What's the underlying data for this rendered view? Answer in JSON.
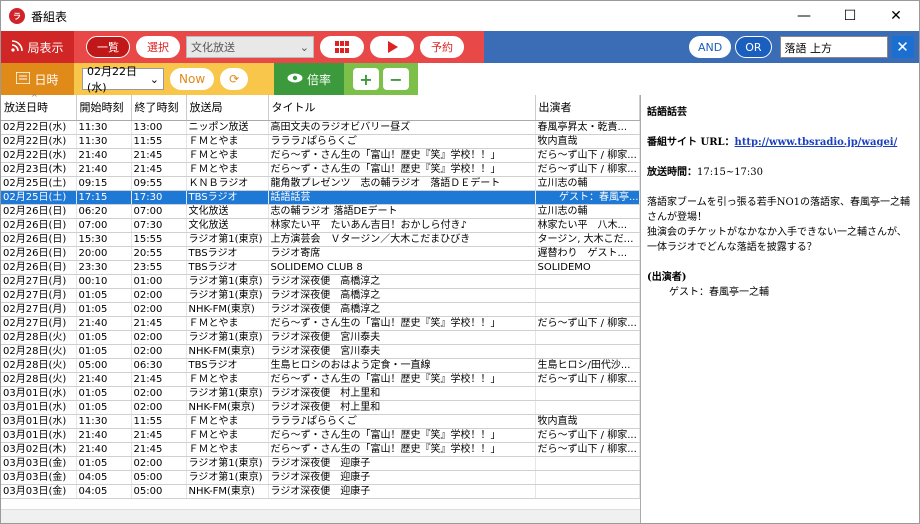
{
  "window": {
    "title": "番組表",
    "app_icon": "ラ",
    "minimize": "—",
    "maximize": "☐",
    "close": "✕"
  },
  "toolbar1": {
    "station_label": "局表示",
    "list_label": "一覧",
    "select_label": "選択",
    "genre_value": "文化放送",
    "reserve_label": "予約",
    "and_label": "AND",
    "or_label": "OR",
    "search_value": "落語 上方"
  },
  "toolbar2": {
    "date_label": "日時",
    "date_value": "02月22日(水)",
    "now_label": "Now",
    "rate_label": "倍率",
    "plus": "+",
    "minus": "−"
  },
  "table": {
    "headers": [
      "放送日時",
      "開始時刻",
      "終了時刻",
      "放送局",
      "タイトル",
      "出演者"
    ],
    "rows": [
      [
        "02月22日(水)",
        "11:30",
        "13:00",
        "ニッポン放送",
        "高田文夫のラジオビバリー昼ズ",
        "春風亭昇太・乾貴..."
      ],
      [
        "02月22日(水)",
        "11:30",
        "11:55",
        "ＦＭとやま",
        "ラララ♪ぱららくご",
        "牧内直哉"
      ],
      [
        "02月22日(水)",
        "21:40",
        "21:45",
        "ＦＭとやま",
        "だら～ず・さん生の「富山！歴史『笑』学校！！」",
        "だら～ず山下 / 柳家..."
      ],
      [
        "02月23日(木)",
        "21:40",
        "21:45",
        "ＦＭとやま",
        "だら～ず・さん生の「富山！歴史『笑』学校！！」",
        "だら～ず山下 / 柳家..."
      ],
      [
        "02月25日(土)",
        "09:15",
        "09:55",
        "ＫＮＢラジオ",
        "龍角散プレゼンツ　志の輔ラジオ　落語ＤＥデート",
        "立川志の輔"
      ],
      [
        "02月25日(土)",
        "17:15",
        "17:30",
        "TBSラジオ",
        "話語話芸",
        "ゲスト：春風亭..."
      ],
      [
        "02月26日(日)",
        "06:20",
        "07:00",
        "文化放送",
        "志の輔ラジオ 落語DEデート",
        "立川志の輔"
      ],
      [
        "02月26日(日)",
        "07:00",
        "07:30",
        "文化放送",
        "林家たい平　たいあん吉日！おかしら付き♪",
        "林家たい平　八木..."
      ],
      [
        "02月26日(日)",
        "15:30",
        "15:55",
        "ラジオ第1(東京)",
        "上方演芸会　Ｖタージン／大木こだまひびき",
        "タージン, 大木こだま..."
      ],
      [
        "02月26日(日)",
        "20:00",
        "20:55",
        "TBSラジオ",
        "ラジオ寄席",
        "遅替わり　ゲスト..."
      ],
      [
        "02月26日(日)",
        "23:30",
        "23:55",
        "TBSラジオ",
        "SOLIDEMO CLUB 8",
        "SOLIDEMO"
      ],
      [
        "02月27日(月)",
        "00:10",
        "01:00",
        "ラジオ第1(東京)",
        "ラジオ深夜便　高橋淳之",
        ""
      ],
      [
        "02月27日(月)",
        "01:05",
        "02:00",
        "ラジオ第1(東京)",
        "ラジオ深夜便　高橋淳之",
        ""
      ],
      [
        "02月27日(月)",
        "01:05",
        "02:00",
        "NHK-FM(東京)",
        "ラジオ深夜便　高橋淳之",
        ""
      ],
      [
        "02月27日(月)",
        "21:40",
        "21:45",
        "ＦＭとやま",
        "だら～ず・さん生の「富山！歴史『笑』学校！！」",
        "だら～ず山下 / 柳家..."
      ],
      [
        "02月28日(火)",
        "01:05",
        "02:00",
        "ラジオ第1(東京)",
        "ラジオ深夜便　宮川泰夫",
        ""
      ],
      [
        "02月28日(火)",
        "01:05",
        "02:00",
        "NHK-FM(東京)",
        "ラジオ深夜便　宮川泰夫",
        ""
      ],
      [
        "02月28日(火)",
        "05:00",
        "06:30",
        "TBSラジオ",
        "生島ヒロシのおはよう定食・一直線",
        "生島ヒロシ/田代沙..."
      ],
      [
        "02月28日(火)",
        "21:40",
        "21:45",
        "ＦＭとやま",
        "だら～ず・さん生の「富山！歴史『笑』学校！！」",
        "だら～ず山下 / 柳家..."
      ],
      [
        "03月01日(水)",
        "01:05",
        "02:00",
        "ラジオ第1(東京)",
        "ラジオ深夜便　村上里和",
        ""
      ],
      [
        "03月01日(水)",
        "01:05",
        "02:00",
        "NHK-FM(東京)",
        "ラジオ深夜便　村上里和",
        ""
      ],
      [
        "03月01日(水)",
        "11:30",
        "11:55",
        "ＦＭとやま",
        "ラララ♪ぱららくご",
        "牧内直哉"
      ],
      [
        "03月01日(水)",
        "21:40",
        "21:45",
        "ＦＭとやま",
        "だら～ず・さん生の「富山！歴史『笑』学校！！」",
        "だら～ず山下 / 柳家..."
      ],
      [
        "03月02日(木)",
        "21:40",
        "21:45",
        "ＦＭとやま",
        "だら～ず・さん生の「富山！歴史『笑』学校！！」",
        "だら～ず山下 / 柳家..."
      ],
      [
        "03月03日(金)",
        "01:05",
        "02:00",
        "ラジオ第1(東京)",
        "ラジオ深夜便　迎康子",
        ""
      ],
      [
        "03月03日(金)",
        "04:05",
        "05:00",
        "ラジオ第1(東京)",
        "ラジオ深夜便　迎康子",
        ""
      ],
      [
        "03月03日(金)",
        "04:05",
        "05:00",
        "NHK-FM(東京)",
        "ラジオ深夜便　迎康子",
        ""
      ]
    ],
    "selected_index": 5
  },
  "detail": {
    "title": "話語話芸",
    "site_label": "番組サイト URL：",
    "site_url": "http://www.tbsradio.jp/wagei/",
    "time_label": "放送時間：",
    "time_value": "17:15~17:30",
    "desc1": "落語家ブームを引っ張る若手NO1の落語家、春風亭一之輔さんが登場！",
    "desc2": "独演会のチケットがなかなか入手できない一之輔さんが、一体ラジオでどんな落語を披露する？",
    "cast_label": "(出演者)",
    "cast_value": "ゲスト：春風亭一之輔"
  },
  "colors": {
    "red": "#e84848",
    "blue": "#3a6db5",
    "orange": "#e08a1a",
    "yellow": "#f8c64a",
    "green": "#3c9a3c",
    "select": "#1e78d6"
  }
}
